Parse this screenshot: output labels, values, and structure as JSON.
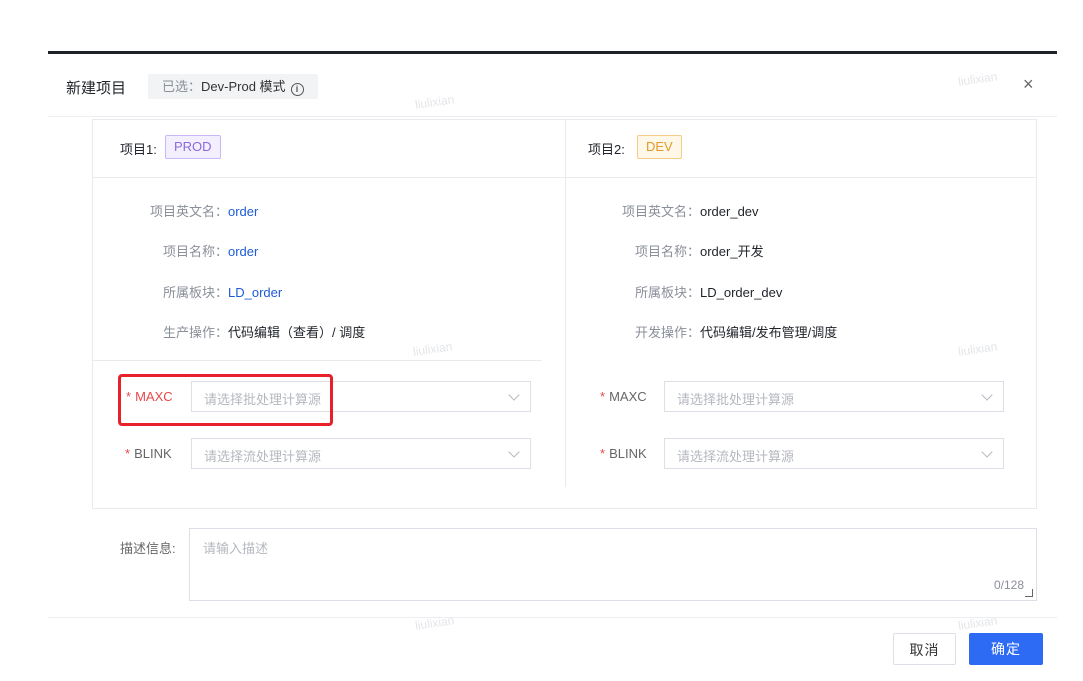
{
  "header": {
    "title": "新建项目",
    "selected_prefix": "已选：",
    "selected_value": "Dev-Prod 模式",
    "info_icon": "info-icon",
    "close_icon": "close-icon",
    "close_symbol": "×"
  },
  "projects": [
    {
      "label": "项目1:",
      "env": "PROD",
      "fields": [
        {
          "key": "项目英文名：",
          "value": "order"
        },
        {
          "key": "项目名称：",
          "value": "order"
        },
        {
          "key": "所属板块：",
          "value": "LD_order"
        },
        {
          "key": "生产操作：",
          "value": "代码编辑（查看）/ 调度"
        }
      ],
      "maxc_label": "MAXC",
      "maxc_placeholder": "请选择批处理计算源",
      "blink_label": "BLINK",
      "blink_placeholder": "请选择流处理计算源"
    },
    {
      "label": "项目2:",
      "env": "DEV",
      "fields": [
        {
          "key": "项目英文名：",
          "value": "order_dev"
        },
        {
          "key": "项目名称：",
          "value": "order_开发"
        },
        {
          "key": "所属板块：",
          "value": "LD_order_dev"
        },
        {
          "key": "开发操作：",
          "value": "代码编辑/发布管理/调度"
        }
      ],
      "maxc_label": "MAXC",
      "maxc_placeholder": "请选择批处理计算源",
      "blink_label": "BLINK",
      "blink_placeholder": "请选择流处理计算源"
    }
  ],
  "required_mark": "*",
  "description": {
    "label": "描述信息:",
    "placeholder": "请输入描述",
    "counter": "0/128"
  },
  "footer": {
    "cancel_label": "取消",
    "ok_label": "确定"
  },
  "watermark": "liulixian",
  "colors": {
    "accent": "#2d6bf5",
    "prod_tag": "#8b6bdc",
    "dev_tag": "#e39a2a",
    "required": "#e8484b",
    "highlight": "#e8202a",
    "link_value": "#1e5bd8"
  }
}
